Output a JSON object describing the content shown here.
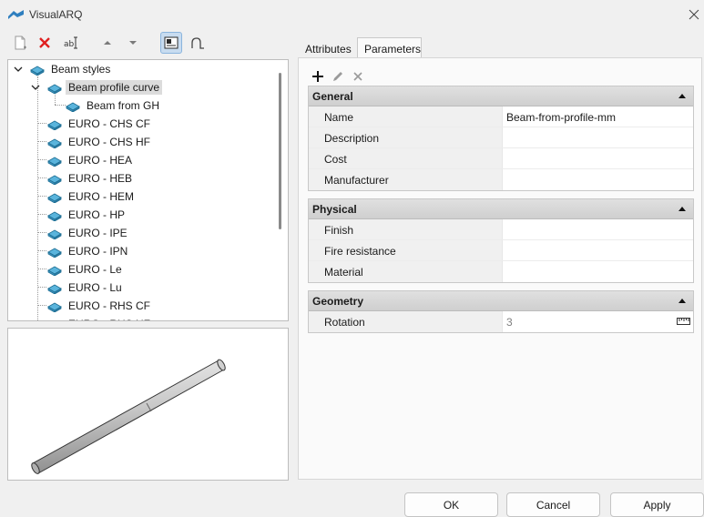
{
  "window": {
    "title": "VisualARQ"
  },
  "toolbar": {
    "icons": [
      "new-style-icon",
      "delete-icon",
      "rename-icon",
      "move-up-icon",
      "move-down-icon",
      "view-mode-icon",
      "curve-icon"
    ]
  },
  "tree": {
    "root": "Beam styles",
    "selected": "Beam profile curve",
    "child": "Beam from GH",
    "items": [
      "EURO - CHS CF",
      "EURO - CHS HF",
      "EURO - HEA",
      "EURO - HEB",
      "EURO - HEM",
      "EURO - HP",
      "EURO - IPE",
      "EURO - IPN",
      "EURO - Le",
      "EURO - Lu",
      "EURO - RHS CF",
      "EURO - RHS HF"
    ]
  },
  "tabs": [
    "Attributes",
    "Parameters"
  ],
  "active_tab": "Parameters",
  "groups": [
    {
      "title": "General",
      "rows": [
        {
          "name": "Name",
          "value": "Beam-from-profile-mm"
        },
        {
          "name": "Description",
          "value": ""
        },
        {
          "name": "Cost",
          "value": ""
        },
        {
          "name": "Manufacturer",
          "value": ""
        }
      ]
    },
    {
      "title": "Physical",
      "rows": [
        {
          "name": "Finish",
          "value": ""
        },
        {
          "name": "Fire resistance",
          "value": ""
        },
        {
          "name": "Material",
          "value": ""
        }
      ]
    },
    {
      "title": "Geometry",
      "rows": [
        {
          "name": "Rotation",
          "value": "3"
        }
      ]
    }
  ],
  "buttons": {
    "ok": "OK",
    "cancel": "Cancel",
    "apply": "Apply"
  },
  "colors": {
    "accent": "#2f7fbf",
    "delete": "#e02020",
    "selection": "#dcdcdc"
  }
}
